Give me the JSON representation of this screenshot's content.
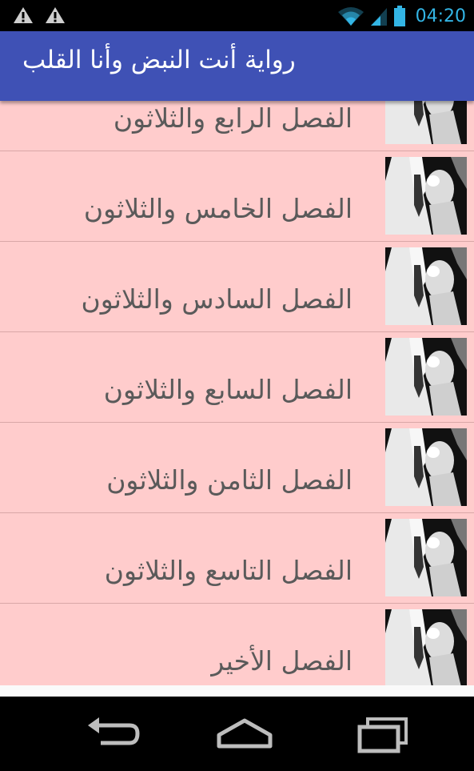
{
  "status_bar": {
    "time": "04:20",
    "left_icons": [
      "warning-icon",
      "warning-icon"
    ],
    "right_icons": [
      "wifi-icon",
      "cell-signal-icon",
      "battery-icon"
    ],
    "accent_color": "#33b5e5"
  },
  "app_bar": {
    "title": "رواية أنت النبض وأنا القلب",
    "background": "#3f51b5"
  },
  "chapters": [
    {
      "title": "الفصل الرابع والثلاثون",
      "thumbnail": "cover-image"
    },
    {
      "title": "الفصل الخامس والثلاثون",
      "thumbnail": "cover-image"
    },
    {
      "title": "الفصل السادس والثلاثون",
      "thumbnail": "cover-image"
    },
    {
      "title": "الفصل السابع والثلاثون",
      "thumbnail": "cover-image"
    },
    {
      "title": "الفصل الثامن والثلاثون",
      "thumbnail": "cover-image"
    },
    {
      "title": "الفصل التاسع والثلاثون",
      "thumbnail": "cover-image"
    },
    {
      "title": "الفصل الأخير",
      "thumbnail": "cover-image"
    }
  ],
  "list_background": "#ffcccc",
  "nav_bar": {
    "buttons": [
      "back-icon",
      "home-icon",
      "recents-icon"
    ]
  }
}
